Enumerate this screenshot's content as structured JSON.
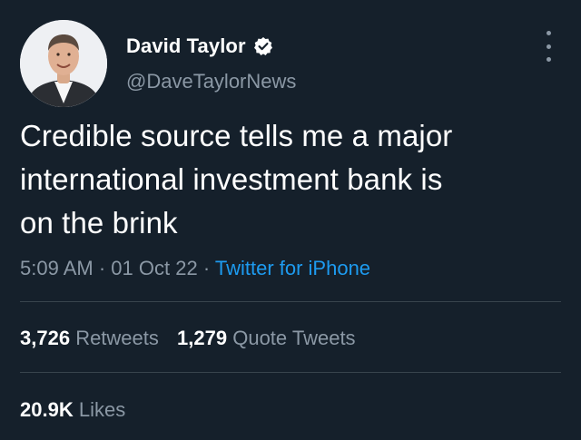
{
  "author": {
    "display_name": "David Taylor",
    "handle": "@DaveTaylorNews",
    "verified_icon": "verified-badge-icon",
    "avatar_icon": "profile-photo"
  },
  "tweet": {
    "text_lines": [
      "Credible source tells me a major",
      "international investment bank is",
      "on the brink"
    ],
    "time": "5:09 AM",
    "date": "01 Oct 22",
    "separator": "·",
    "source": "Twitter for iPhone"
  },
  "stats": {
    "retweets_count": "3,726",
    "retweets_label": "Retweets",
    "quote_count": "1,279",
    "quote_label": "Quote Tweets",
    "likes_count": "20.9K",
    "likes_label": "Likes"
  },
  "colors": {
    "background": "#15202b",
    "text_primary": "#ffffff",
    "text_secondary": "#8b98a5",
    "accent": "#1d9bf0",
    "divider": "#38444d"
  }
}
